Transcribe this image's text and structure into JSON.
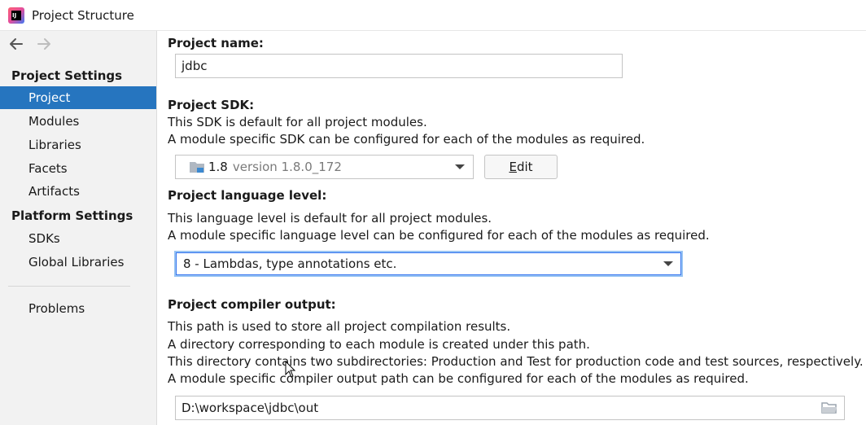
{
  "window": {
    "title": "Project Structure",
    "app_icon_text": "IJ"
  },
  "sidebar": {
    "sections": [
      {
        "header": "Project Settings",
        "items": [
          "Project",
          "Modules",
          "Libraries",
          "Facets",
          "Artifacts"
        ]
      },
      {
        "header": "Platform Settings",
        "items": [
          "SDKs",
          "Global Libraries"
        ]
      }
    ],
    "problems": "Problems",
    "selected": "Project"
  },
  "main": {
    "project_name": {
      "label": "Project name:",
      "value": "jdbc"
    },
    "project_sdk": {
      "label": "Project SDK:",
      "desc1": "This SDK is default for all project modules.",
      "desc2": "A module specific SDK can be configured for each of the modules as required.",
      "sdk_name": "1.8",
      "sdk_version": "version 1.8.0_172",
      "edit_prefix": "",
      "edit_mnemonic": "E",
      "edit_rest": "dit"
    },
    "language_level": {
      "label": "Project language level:",
      "desc1": "This language level is default for all project modules.",
      "desc2": "A module specific language level can be configured for each of the modules as required.",
      "value": "8 - Lambdas, type annotations etc."
    },
    "compiler_output": {
      "label": "Project compiler output:",
      "desc1": "This path is used to store all project compilation results.",
      "desc2": "A directory corresponding to each module is created under this path.",
      "desc3": "This directory contains two subdirectories: Production and Test for production code and test sources, respectively.",
      "desc4": "A module specific compiler output path can be configured for each of the modules as required.",
      "path": "D:\\workspace\\jdbc\\out"
    }
  },
  "icons": {
    "back": "arrow-left-icon",
    "forward": "arrow-right-icon",
    "folder": "folder-icon",
    "sdk": "sdk-folder-icon"
  },
  "colors": {
    "selection": "#2675bf",
    "focus": "#3574f0"
  }
}
